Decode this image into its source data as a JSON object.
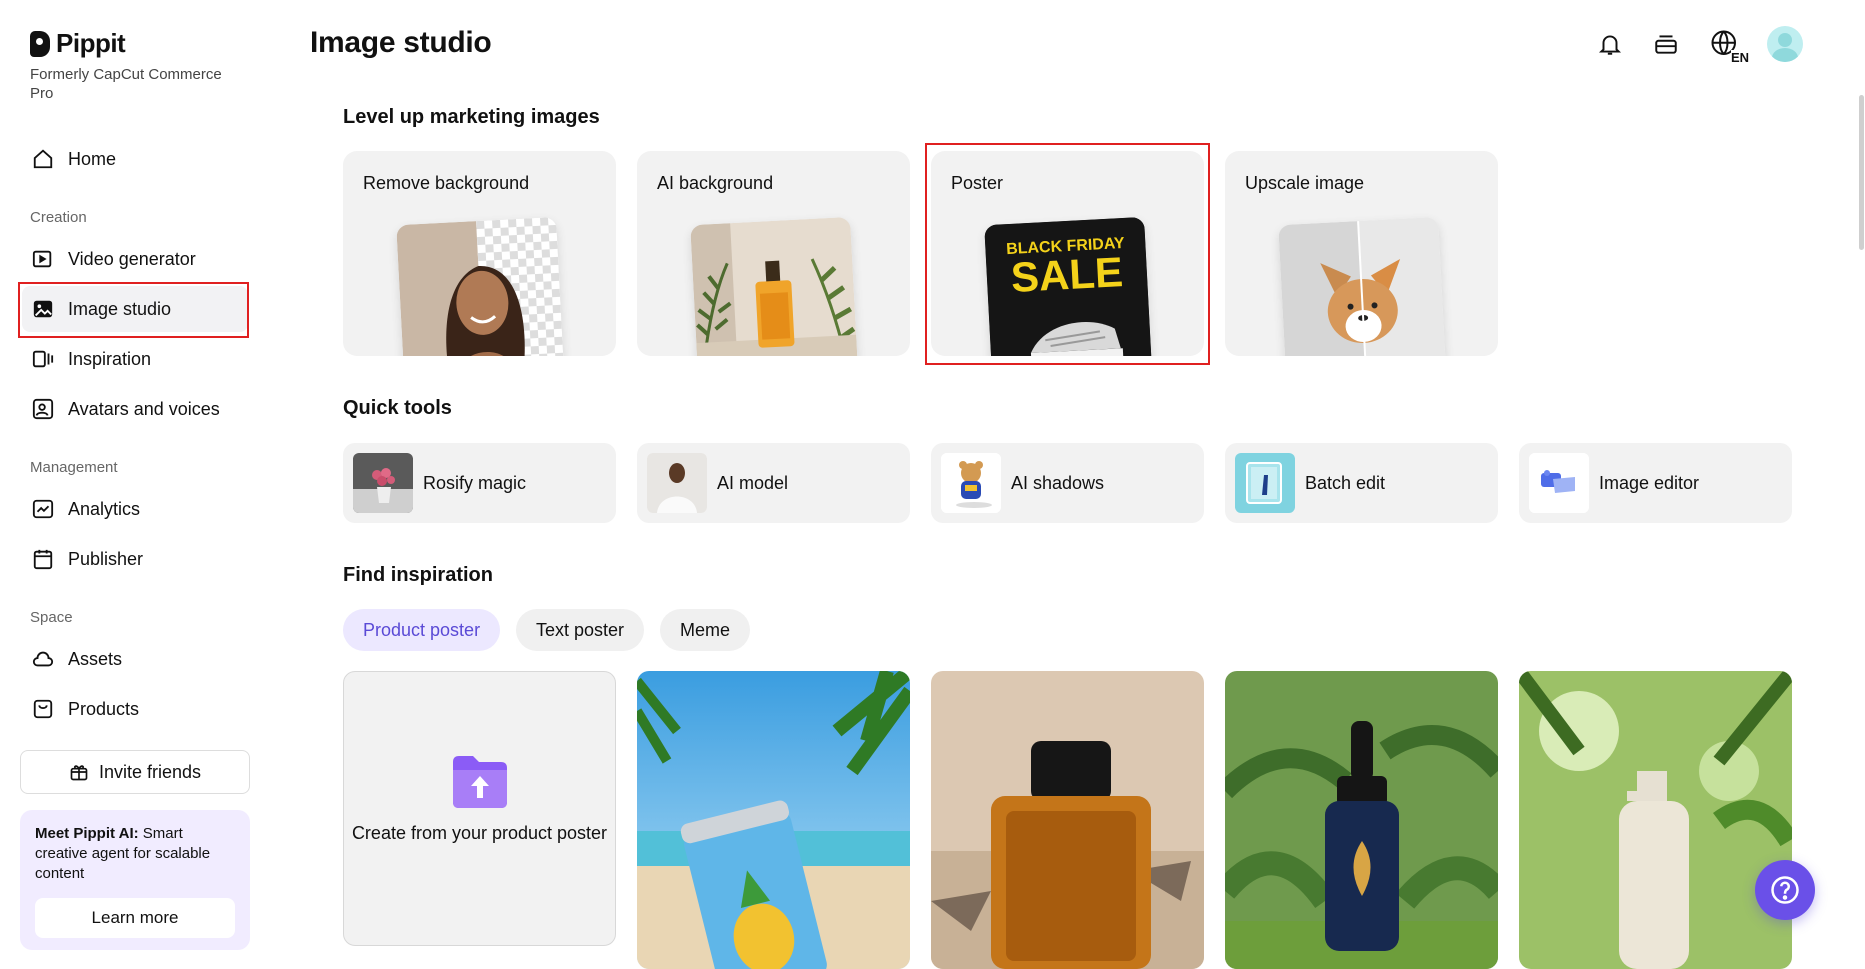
{
  "brand": {
    "name": "Pippit",
    "formerly": "Formerly CapCut Commerce Pro"
  },
  "sidebar": {
    "home": "Home",
    "creation_label": "Creation",
    "creation_items": [
      "Video generator",
      "Image studio",
      "Inspiration",
      "Avatars and voices"
    ],
    "management_label": "Management",
    "management_items": [
      "Analytics",
      "Publisher"
    ],
    "space_label": "Space",
    "space_items": [
      "Assets",
      "Products"
    ],
    "invite": "Invite friends",
    "promo": {
      "bold": "Meet Pippit AI:",
      "text": " Smart creative agent for scalable content",
      "button": "Learn more"
    },
    "active_item": "Image studio"
  },
  "header": {
    "title": "Image studio",
    "language_badge": "EN"
  },
  "level_up": {
    "heading": "Level up marketing images",
    "cards": [
      "Remove background",
      "AI background",
      "Poster",
      "Upscale image"
    ],
    "poster_thumb": {
      "line1": "BLACK FRIDAY",
      "line2": "SALE"
    }
  },
  "quick_tools": {
    "heading": "Quick tools",
    "items": [
      "Rosify magic",
      "AI model",
      "AI shadows",
      "Batch edit",
      "Image editor"
    ]
  },
  "find_inspiration": {
    "heading": "Find inspiration",
    "tabs": [
      "Product poster",
      "Text poster",
      "Meme"
    ],
    "active_tab": "Product poster",
    "upload_label": "Create from your product poster"
  },
  "colors": {
    "accent": "#6a50e8",
    "highlight": "#e02020",
    "card_bg": "#f2f2f2"
  }
}
